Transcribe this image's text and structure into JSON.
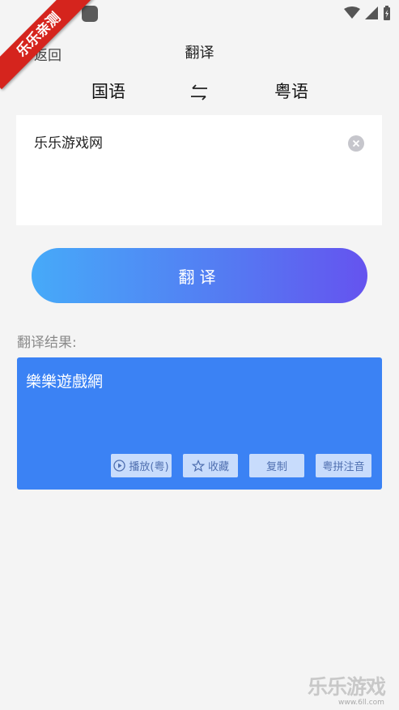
{
  "ribbon": {
    "text": "乐乐亲测"
  },
  "nav": {
    "back_label": "返回",
    "title": "翻译"
  },
  "languages": {
    "source": "国语",
    "swap_icon": "swap-arrows-icon",
    "target": "粤语"
  },
  "input": {
    "text": "乐乐游戏网"
  },
  "translate_button": {
    "label": "翻译"
  },
  "result": {
    "label": "翻译结果:",
    "text": "樂樂遊戲網",
    "actions": {
      "play": "播放(粤)",
      "favorite": "收藏",
      "copy": "复制",
      "pinyin": "粤拼注音"
    }
  },
  "watermark": {
    "brand": "乐乐游戏",
    "url": "www.6ll.com"
  },
  "colors": {
    "accent": "#3b82f4",
    "gradient_start": "#46aaf9",
    "gradient_end": "#6553ef",
    "ribbon": "#d5241d"
  }
}
